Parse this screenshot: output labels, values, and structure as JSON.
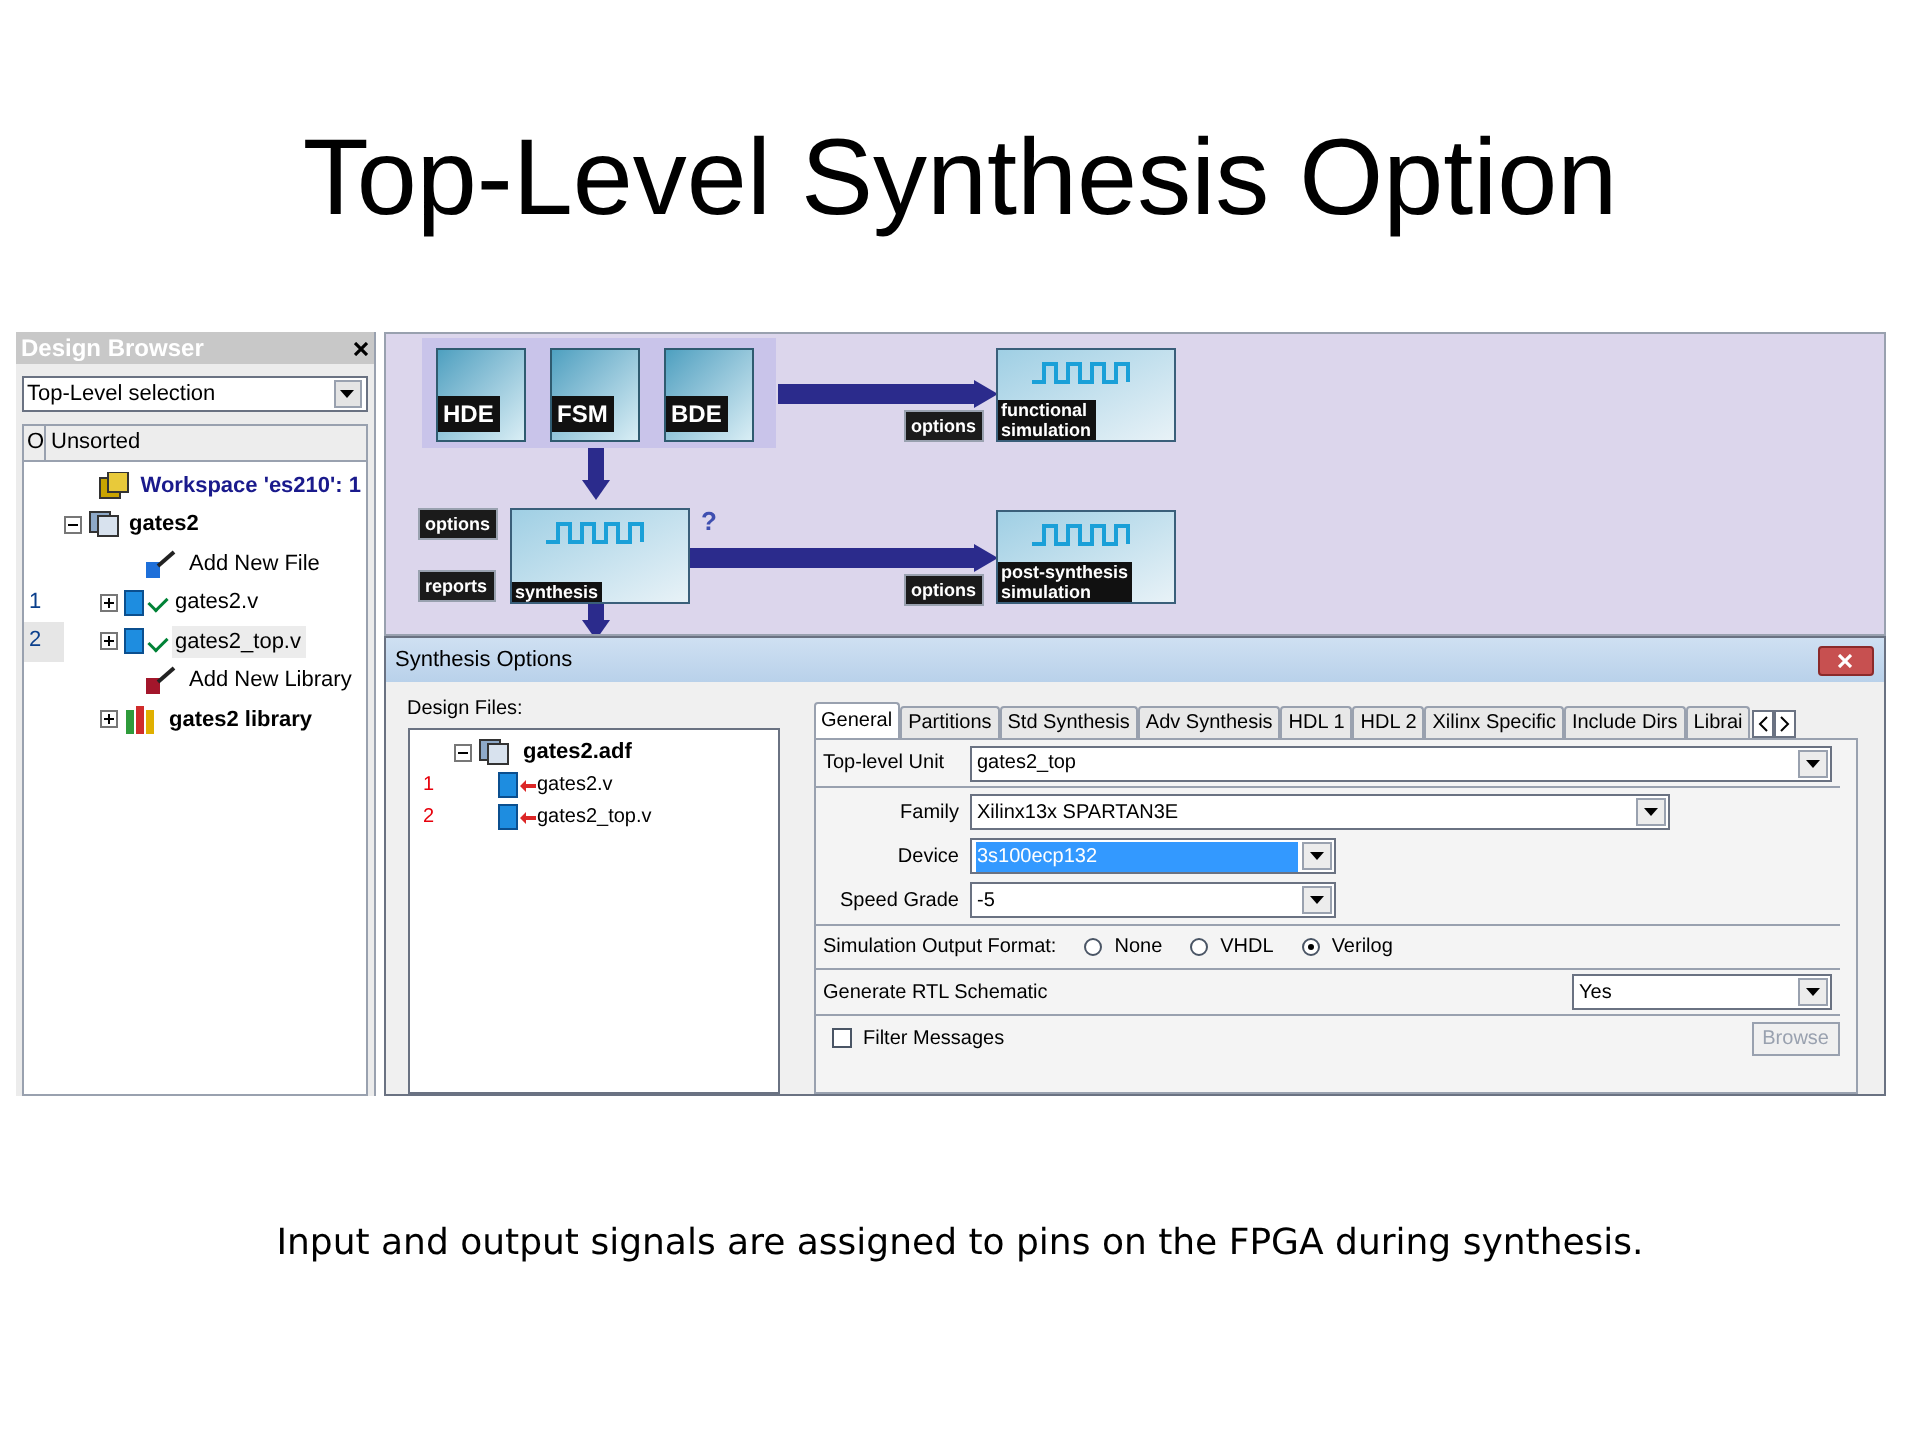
{
  "slide_title": "Top-Level Synthesis Option",
  "design_browser": {
    "title": "Design Browser",
    "selector": "Top-Level selection",
    "columns": [
      "O",
      "Unsorted"
    ],
    "tree": [
      {
        "label": "Workspace 'es210': 1",
        "kind": "workspace",
        "selected": false
      },
      {
        "label": "gates2",
        "kind": "design",
        "expanded": true,
        "selected": false,
        "children": [
          {
            "label": "Add New File",
            "kind": "add-file",
            "selected": false
          },
          {
            "order": "1",
            "label": "gates2.v",
            "kind": "file",
            "expanded": false,
            "checked": true,
            "selected": false
          },
          {
            "order": "2",
            "label": "gates2_top.v",
            "kind": "file",
            "expanded": false,
            "checked": true,
            "selected": true
          },
          {
            "label": "Add New Library",
            "kind": "add-library",
            "selected": false
          },
          {
            "label": "gates2 library",
            "kind": "library",
            "expanded": false,
            "selected": false
          }
        ]
      }
    ]
  },
  "flow": {
    "tools": [
      "HDE",
      "FSM",
      "BDE"
    ],
    "functional_sim": [
      "functional",
      "simulation"
    ],
    "functional_options": "options",
    "synthesis_options": "options",
    "synthesis_reports": "reports",
    "synthesis": "synthesis",
    "help": "?",
    "post_sim": [
      "post-synthesis",
      "simulation"
    ],
    "post_options": "options"
  },
  "dialog": {
    "title": "Synthesis Options",
    "design_files_label": "Design Files:",
    "files": {
      "label": "gates2.adf",
      "children": [
        {
          "order": "1",
          "label": "gates2.v"
        },
        {
          "order": "2",
          "label": "gates2_top.v"
        }
      ]
    },
    "tabs": [
      {
        "label": "General",
        "selected": true
      },
      {
        "label": "Partitions",
        "selected": false
      },
      {
        "label": "Std Synthesis",
        "selected": false
      },
      {
        "label": "Adv Synthesis",
        "selected": false
      },
      {
        "label": "HDL 1",
        "selected": false
      },
      {
        "label": "HDL 2",
        "selected": false
      },
      {
        "label": "Xilinx Specific",
        "selected": false
      },
      {
        "label": "Include Dirs",
        "selected": false
      },
      {
        "label": "Librai",
        "selected": false
      }
    ],
    "top_level_unit": {
      "label": "Top-level Unit",
      "value": "gates2_top"
    },
    "device_fields": [
      {
        "label": "Family",
        "value": "Xilinx13x SPARTAN3E",
        "highlighted": false,
        "kind": "wide"
      },
      {
        "label": "Device",
        "value": "3s100ecp132",
        "highlighted": true,
        "kind": "narrow"
      },
      {
        "label": "Speed Grade",
        "value": "-5",
        "highlighted": false,
        "kind": "narrow"
      }
    ],
    "sim_format": {
      "label": "Simulation Output Format:",
      "options": [
        {
          "label": "None",
          "selected": false
        },
        {
          "label": "VHDL",
          "selected": false
        },
        {
          "label": "Verilog",
          "selected": true
        }
      ]
    },
    "rtl": {
      "label": "Generate RTL Schematic",
      "value": "Yes"
    },
    "filter": {
      "label": "Filter Messages",
      "checked": false
    },
    "browse": {
      "label": "Browse",
      "disabled": true
    }
  },
  "caption": "Input and output signals are assigned to pins on the FPGA during synthesis."
}
